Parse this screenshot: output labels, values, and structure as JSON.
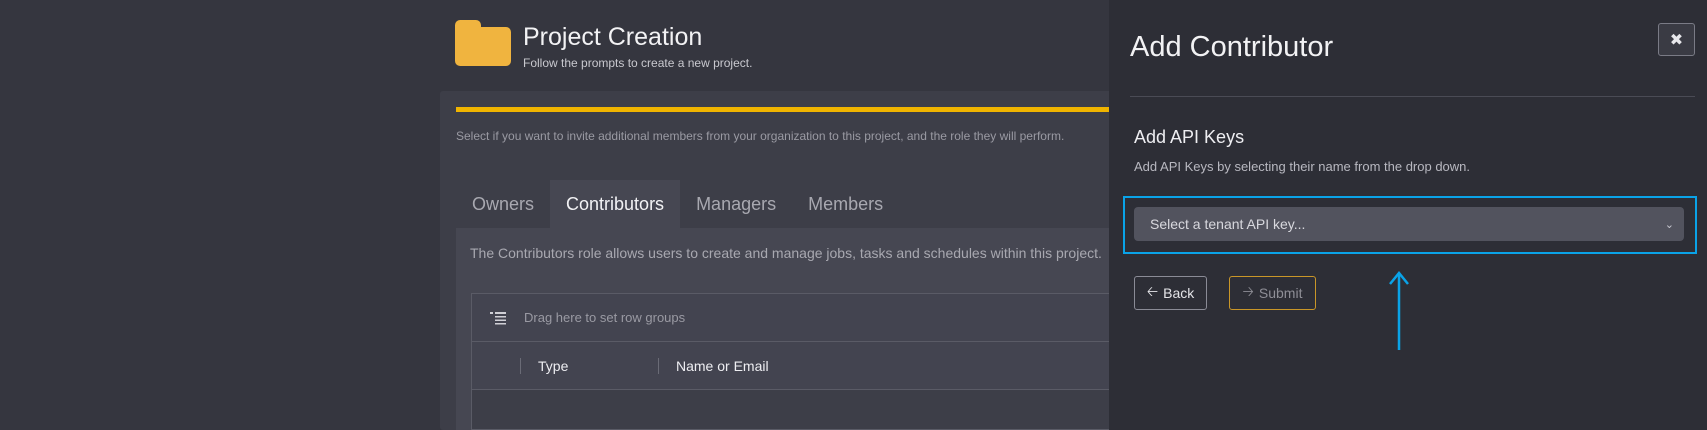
{
  "header": {
    "icon": "folder-icon",
    "title": "Project Creation",
    "subtitle": "Follow the prompts to create a new project."
  },
  "wizard": {
    "description": "Select if you want to invite additional members from your organization to this project, and the role they will perform.",
    "progress_color": "#f0b400",
    "tabs": [
      {
        "label": "Owners",
        "active": false
      },
      {
        "label": "Contributors",
        "active": true
      },
      {
        "label": "Managers",
        "active": false
      },
      {
        "label": "Members",
        "active": false
      }
    ],
    "role_description": "The Contributors role allows users to create and manage jobs, tasks and schedules within this project.",
    "grid": {
      "group_hint": "Drag here to set row groups",
      "columns": [
        "Type",
        "Name or Email"
      ]
    }
  },
  "drawer": {
    "title": "Add Contributor",
    "close_icon": "close-icon",
    "section_title": "Add API Keys",
    "section_description": "Add API Keys by selecting their name from the drop down.",
    "select_placeholder": "Select a tenant API key...",
    "back_label": "Back",
    "submit_label": "Submit",
    "highlight_color": "#0aa3e8"
  }
}
